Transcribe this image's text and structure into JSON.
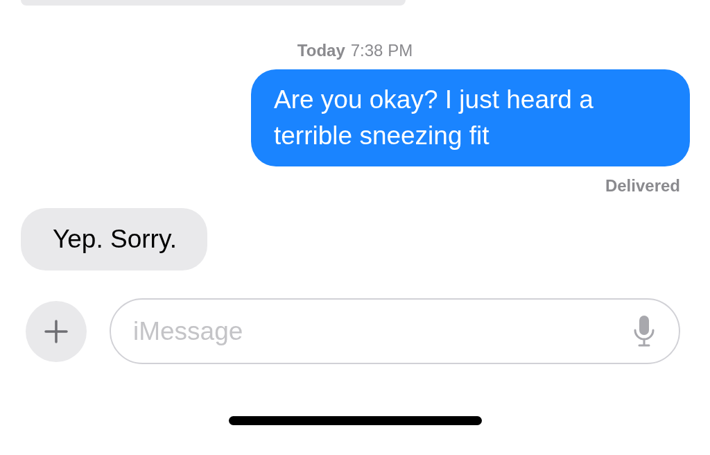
{
  "timestamp": {
    "day": "Today",
    "time": "7:38 PM"
  },
  "messages": [
    {
      "kind": "outgoing",
      "text": "Are you okay? I just heard a terrible sneezing fit",
      "status": "Delivered"
    },
    {
      "kind": "incoming",
      "text": "Yep. Sorry."
    }
  ],
  "composer": {
    "placeholder": "iMessage"
  }
}
